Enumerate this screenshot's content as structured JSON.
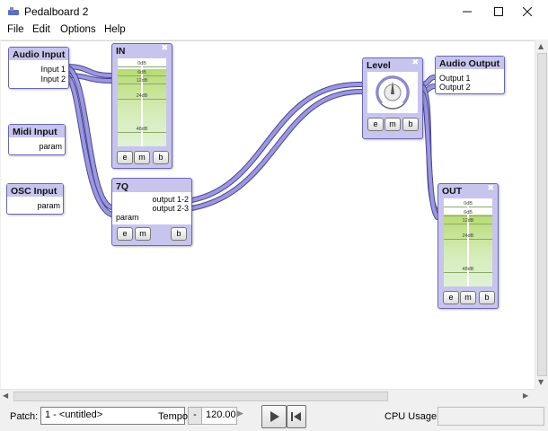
{
  "window": {
    "title": "Pedalboard 2",
    "minimize_icon": "minimize-icon",
    "maximize_icon": "maximize-icon",
    "close_icon": "close-icon"
  },
  "menu": [
    "File",
    "Edit",
    "Options",
    "Help"
  ],
  "blocks": {
    "audio_input": {
      "title": "Audio Input",
      "ports": [
        "Input 1",
        "Input 2"
      ]
    },
    "midi_input": {
      "title": "Midi Input",
      "ports": [
        "param"
      ]
    },
    "osc_input": {
      "title": "OSC Input",
      "ports": [
        "param"
      ]
    },
    "in_meter": {
      "title": "IN",
      "scale": [
        "0dB",
        "6dB",
        "12dB",
        "24dB",
        "48dB"
      ],
      "buttons": [
        "e",
        "m",
        "b"
      ]
    },
    "seven_q": {
      "title": "7Q",
      "outputs": [
        "output 1-2",
        "output 2-3"
      ],
      "inputs": [
        "param"
      ],
      "buttons": [
        "e",
        "m",
        "b"
      ]
    },
    "level": {
      "title": "Level",
      "buttons": [
        "e",
        "m",
        "b"
      ],
      "knob_value": 0.5
    },
    "audio_output": {
      "title": "Audio Output",
      "ports": [
        "Output 1",
        "Output 2"
      ]
    },
    "out_meter": {
      "title": "OUT",
      "scale": [
        "0dB",
        "6dB",
        "12dB",
        "24dB",
        "48dB"
      ],
      "buttons": [
        "e",
        "m",
        "b"
      ]
    }
  },
  "status": {
    "patch_label": "Patch:",
    "patch_value": "1 - <untitled>",
    "tempo_label": "Tempo:",
    "tempo_minus": "-",
    "tempo_value": "120.00",
    "cpu_label": "CPU Usage:",
    "cpu_value": ""
  },
  "colors": {
    "cable": "#8c88d6",
    "block_header": "#c7c4ee",
    "block_border": "#6b66b3",
    "meter_green": "#b7db72"
  }
}
